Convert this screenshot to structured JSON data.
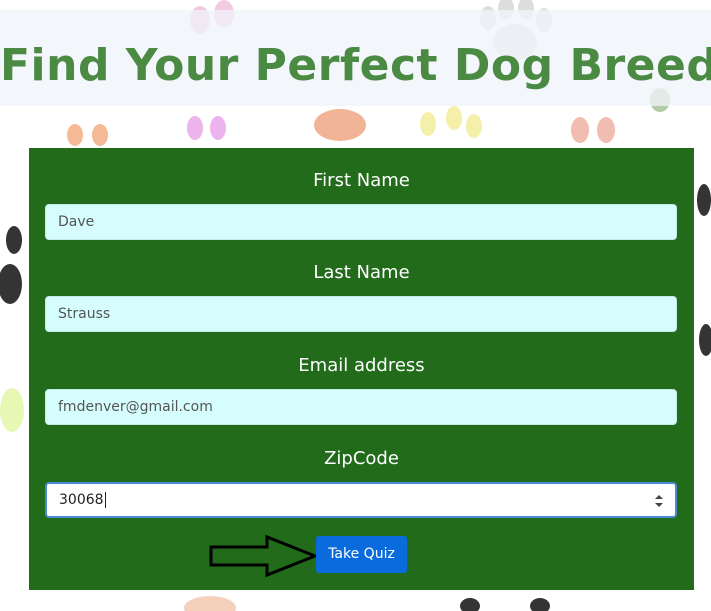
{
  "page": {
    "title": "Find Your Perfect Dog Breed"
  },
  "form": {
    "first_name_label": "First Name",
    "first_name_value": "Dave",
    "last_name_label": "Last Name",
    "last_name_value": "Strauss",
    "email_label": "Email address",
    "email_value": "fmdenver@gmail.com",
    "zip_label": "ZipCode",
    "zip_value": "30068",
    "submit_label": "Take Quiz"
  },
  "colors": {
    "title": "#4a8a43",
    "panel": "#216b1a",
    "input_bg": "#d6fdfd",
    "button": "#0a6cdc"
  },
  "icons": {
    "background": "paw-print-pattern",
    "pointer": "arrow-right-icon",
    "spinner": "number-spinner-icon"
  }
}
